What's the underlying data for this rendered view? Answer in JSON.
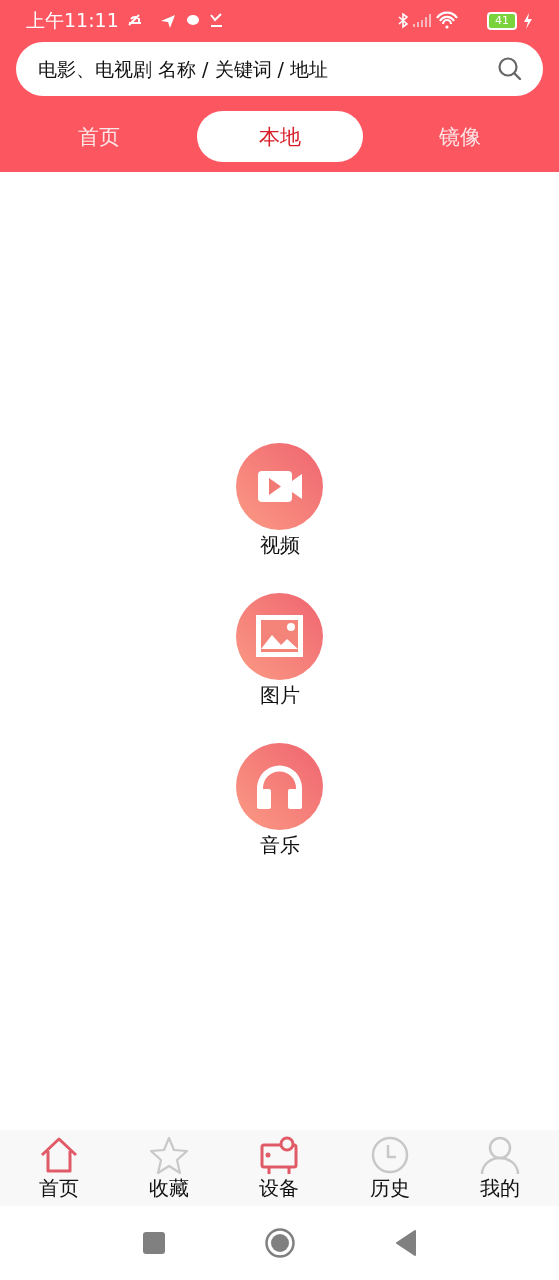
{
  "status_bar": {
    "time": "上午11:11",
    "battery": "41"
  },
  "search": {
    "placeholder": "电影、电视剧 名称 / 关键词 / 地址"
  },
  "tabs": [
    {
      "label": "首页",
      "selected": false
    },
    {
      "label": "本地",
      "selected": true
    },
    {
      "label": "镜像",
      "selected": false
    }
  ],
  "media": [
    {
      "kind": "video",
      "label": "视频"
    },
    {
      "kind": "image",
      "label": "图片"
    },
    {
      "kind": "music",
      "label": "音乐"
    }
  ],
  "bottom_nav": [
    {
      "kind": "home",
      "label": "首页",
      "selected": true
    },
    {
      "kind": "star",
      "label": "收藏",
      "selected": false
    },
    {
      "kind": "device",
      "label": "设备",
      "selected": true
    },
    {
      "kind": "clock",
      "label": "历史",
      "selected": false
    },
    {
      "kind": "person",
      "label": "我的",
      "selected": false
    }
  ]
}
